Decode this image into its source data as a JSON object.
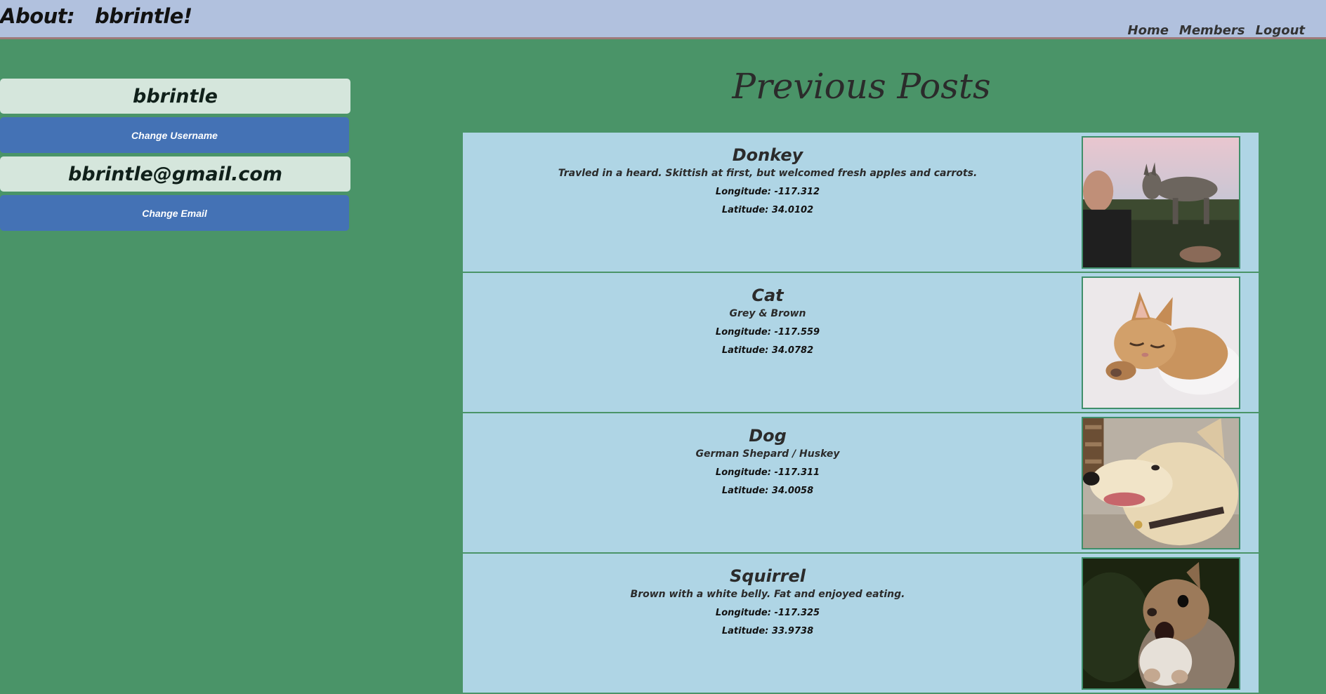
{
  "header": {
    "title": "About:   bbrintle!",
    "nav": [
      "Home",
      "Members",
      "Logout"
    ]
  },
  "sidebar": {
    "username": "bbrintle",
    "change_username_label": "Change Username",
    "email": "bbrintle@gmail.com",
    "change_email_label": "Change Email"
  },
  "main": {
    "title": "Previous Posts",
    "posts": [
      {
        "name": "Donkey",
        "description": "Travled in a heard. Skittish at first, but welcomed fresh apples and carrots.",
        "longitude": "Longitude: -117.312",
        "latitude": "Latitude: 34.0102",
        "image_icon": "donkey-photo"
      },
      {
        "name": "Cat",
        "description": "Grey & Brown",
        "longitude": "Longitude: -117.559",
        "latitude": "Latitude: 34.0782",
        "image_icon": "cat-photo"
      },
      {
        "name": "Dog",
        "description": "German Shepard / Huskey",
        "longitude": "Longitude: -117.311",
        "latitude": "Latitude: 34.0058",
        "image_icon": "dog-photo"
      },
      {
        "name": "Squirrel",
        "description": "Brown with a white belly. Fat and enjoyed eating.",
        "longitude": "Longitude: -117.325",
        "latitude": "Latitude: 33.9738",
        "image_icon": "squirrel-photo"
      }
    ]
  },
  "colors": {
    "page_bg": "#4a9468",
    "header_bg": "#b1c1de",
    "card_bg": "#afd5e5",
    "button_bg": "#4472b5",
    "info_box_bg": "#d5e6dc"
  }
}
